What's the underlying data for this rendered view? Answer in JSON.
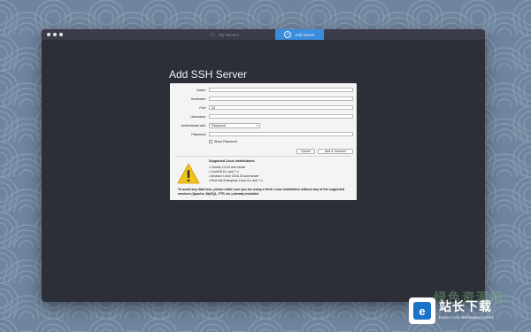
{
  "window": {
    "tabs": [
      {
        "label": "My Servers",
        "icon": "star-icon",
        "active": false
      },
      {
        "label": "Add Server",
        "icon": "plus-circle-icon",
        "active": true
      }
    ]
  },
  "dialog": {
    "title": "Add SSH Server",
    "fields": {
      "name": {
        "label": "Name:",
        "value": ""
      },
      "hostname": {
        "label": "Hostname:",
        "value": ""
      },
      "port": {
        "label": "Port:",
        "value": "22"
      },
      "username": {
        "label": "Username:",
        "value": ""
      },
      "auth": {
        "label": "Authenticate with:",
        "value": "Password"
      },
      "password": {
        "label": "Password:",
        "value": ""
      }
    },
    "show_password_label": "Show Password",
    "buttons": {
      "cancel": "Cancel",
      "add_connect": "Add & Connect"
    },
    "supported": {
      "heading": "Supported Linux distributions:",
      "items": [
        "Ubuntu 14.04 and newer",
        "CentOS 6.x and 7.x",
        "Amazon Linux 2016.03 and newer",
        "Red Hat Enterprise Linux 6.x and 7.x"
      ]
    },
    "note": "To avoid any data loss, please make sure you are using a fresh Linux installation without any of the supported services (Apache, MySQL, FTP, etc.) already installed."
  },
  "watermark": {
    "ghost_text": "绿色资源网",
    "brand": "站长下载",
    "sub": "Eaxos.Com Webmaster Codes",
    "logo_glyph": "e"
  },
  "colors": {
    "desktop": "#6f849d",
    "window_bg": "#2c2e38",
    "accent_tab": "#3b8edd",
    "warning_yellow": "#f2c318"
  }
}
